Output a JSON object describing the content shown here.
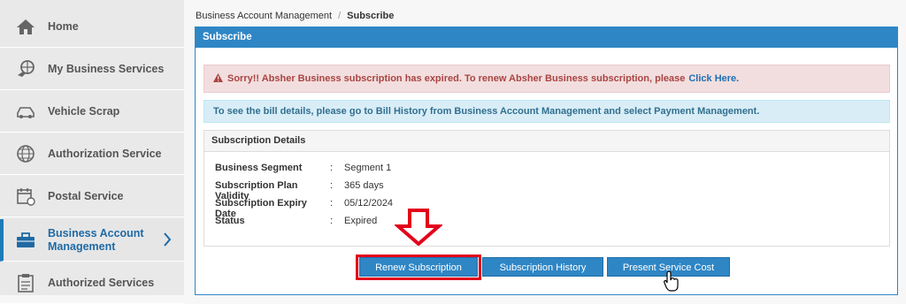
{
  "sidebar": {
    "items": [
      {
        "label": "Home",
        "icon": "home-icon"
      },
      {
        "label": "My Business Services",
        "icon": "globe-hand-icon"
      },
      {
        "label": "Vehicle Scrap",
        "icon": "car-icon"
      },
      {
        "label": "Authorization Service",
        "icon": "globe-icon"
      },
      {
        "label": "Postal Service",
        "icon": "calendar-icon"
      },
      {
        "label": "Business Account Management",
        "icon": "briefcase-icon"
      },
      {
        "label": "Authorized Services",
        "icon": "clipboard-icon"
      }
    ]
  },
  "breadcrumb": {
    "parent": "Business Account Management",
    "separator": "/",
    "current": "Subscribe"
  },
  "panel": {
    "title": "Subscribe"
  },
  "alerts": {
    "expired": "Sorry!! Absher Business subscription has expired. To renew Absher Business subscription, please",
    "expired_link": "Click Here",
    "expired_end": ".",
    "bill": "To see the bill details, please go to Bill History from Business Account Management and select Payment Management."
  },
  "details": {
    "title": "Subscription Details",
    "colon": ":",
    "rows": [
      {
        "key": "Business Segment",
        "value": "Segment 1"
      },
      {
        "key": "Subscription Plan Validity",
        "value": "365 days"
      },
      {
        "key": "Subscription Expiry Date",
        "value": "05/12/2024"
      },
      {
        "key": "Status",
        "value": "Expired"
      }
    ]
  },
  "buttons": {
    "renew": "Renew Subscription",
    "history": "Subscription History",
    "cost": "Present Service Cost"
  },
  "colors": {
    "accent": "#2f86c5",
    "highlight": "#e3001b"
  }
}
